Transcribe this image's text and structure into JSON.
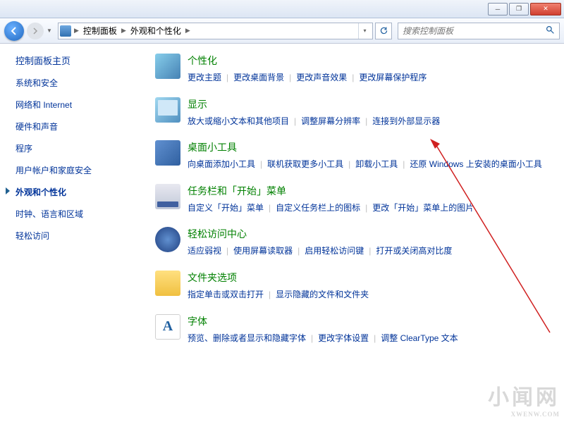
{
  "window": {
    "minimize": "─",
    "maximize": "❐",
    "close": "✕"
  },
  "nav": {
    "crumb1": "控制面板",
    "crumb2": "外观和个性化",
    "search_placeholder": "搜索控制面板"
  },
  "sidebar": {
    "home": "控制面板主页",
    "items": [
      {
        "label": "系统和安全"
      },
      {
        "label": "网络和 Internet"
      },
      {
        "label": "硬件和声音"
      },
      {
        "label": "程序"
      },
      {
        "label": "用户帐户和家庭安全"
      },
      {
        "label": "外观和个性化"
      },
      {
        "label": "时钟、语言和区域"
      },
      {
        "label": "轻松访问"
      }
    ],
    "active_index": 5
  },
  "categories": [
    {
      "icon": "ic-personalize",
      "name": "personalize",
      "title": "个性化",
      "links": [
        "更改主题",
        "更改桌面背景",
        "更改声音效果",
        "更改屏幕保护程序"
      ]
    },
    {
      "icon": "ic-display",
      "name": "display",
      "title": "显示",
      "links": [
        "放大或缩小文本和其他项目",
        "调整屏幕分辨率",
        "连接到外部显示器"
      ]
    },
    {
      "icon": "ic-gadgets",
      "name": "gadgets",
      "title": "桌面小工具",
      "links": [
        "向桌面添加小工具",
        "联机获取更多小工具",
        "卸载小工具",
        "还原 Windows 上安装的桌面小工具"
      ]
    },
    {
      "icon": "ic-taskbar",
      "name": "taskbar",
      "title": "任务栏和「开始」菜单",
      "links": [
        "自定义「开始」菜单",
        "自定义任务栏上的图标",
        "更改「开始」菜单上的图片"
      ]
    },
    {
      "icon": "ic-ease",
      "name": "ease-of-access",
      "title": "轻松访问中心",
      "links": [
        "适应弱视",
        "使用屏幕读取器",
        "启用轻松访问键",
        "打开或关闭高对比度"
      ]
    },
    {
      "icon": "ic-folder",
      "name": "folder-options",
      "title": "文件夹选项",
      "links": [
        "指定单击或双击打开",
        "显示隐藏的文件和文件夹"
      ]
    },
    {
      "icon": "ic-fonts",
      "name": "fonts",
      "title": "字体",
      "links": [
        "预览、删除或者显示和隐藏字体",
        "更改字体设置",
        "调整 ClearType 文本"
      ]
    }
  ],
  "watermark": {
    "main": "小闻网",
    "sub": "XWENW.COM"
  }
}
